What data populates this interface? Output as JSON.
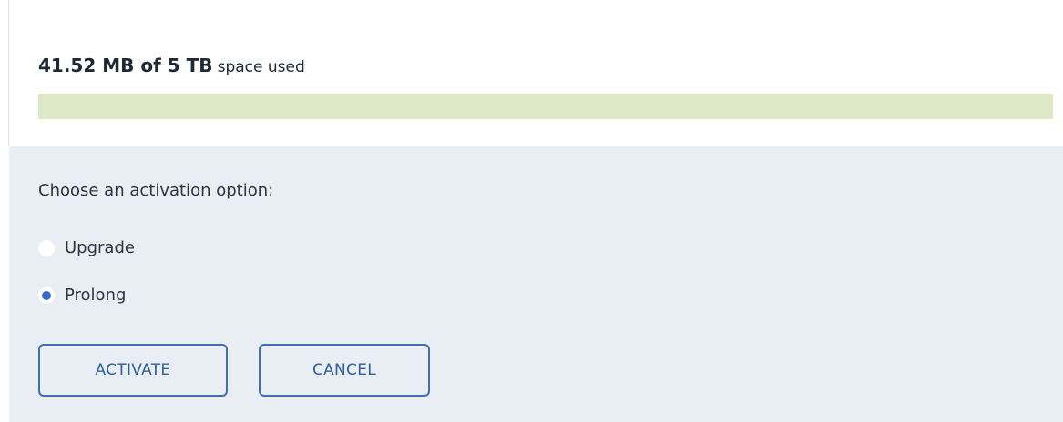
{
  "storage": {
    "used_amount": "41.52 MB of 5 TB",
    "used_suffix": "space used",
    "used_fraction": 8e-06
  },
  "activation": {
    "prompt": "Choose an activation option:",
    "options": [
      {
        "label": "Upgrade",
        "selected": false
      },
      {
        "label": "Prolong",
        "selected": true
      }
    ]
  },
  "buttons": {
    "activate_label": "ACTIVATE",
    "cancel_label": "CANCEL"
  },
  "colors": {
    "accent": "#3d70b2",
    "radio_selected": "#3a6ac8",
    "progress_track": "#dde8c7",
    "options_background": "#e9eef4"
  }
}
